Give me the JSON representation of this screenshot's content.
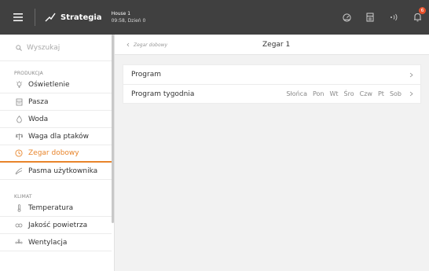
{
  "topbar": {
    "brand": "Strategia",
    "house_name": "House 1",
    "house_info": "09:58, Dzień 0",
    "badge_count": "6",
    "colors": {
      "bar": "#404040",
      "badge": "#e8502a"
    },
    "icons": [
      "menu-icon",
      "strategia-logo-icon",
      "dashboard-icon",
      "document-icon",
      "signal-icon",
      "bell-icon"
    ]
  },
  "sidebar": {
    "search_placeholder": "Wyszukaj",
    "sections": [
      {
        "label": "PRODUKCJA",
        "items": [
          {
            "label": "Oświetlenie",
            "icon": "lightbulb-icon"
          },
          {
            "label": "Pasza",
            "icon": "feed-icon"
          },
          {
            "label": "Woda",
            "icon": "water-drop-icon"
          },
          {
            "label": "Waga dla ptaków",
            "icon": "scale-icon"
          },
          {
            "label": "Zegar dobowy",
            "icon": "clock-icon",
            "active": true
          },
          {
            "label": "Pasma użytkownika",
            "icon": "user-band-icon"
          }
        ]
      },
      {
        "label": "KLIMAT",
        "items": [
          {
            "label": "Temperatura",
            "icon": "thermometer-icon"
          },
          {
            "label": "Jakość powietrza",
            "icon": "co2-icon"
          },
          {
            "label": "Wentylacja",
            "icon": "fan-icon"
          }
        ]
      }
    ],
    "active_color": "#e8842a"
  },
  "main": {
    "breadcrumb": "Zegar dobowy",
    "title": "Zegar 1",
    "rows": [
      {
        "label": "Program"
      },
      {
        "label": "Program tygodnia",
        "days": [
          "Słońca",
          "Pon",
          "Wt",
          "Śro",
          "Czw",
          "Pt",
          "Sob"
        ]
      }
    ]
  }
}
